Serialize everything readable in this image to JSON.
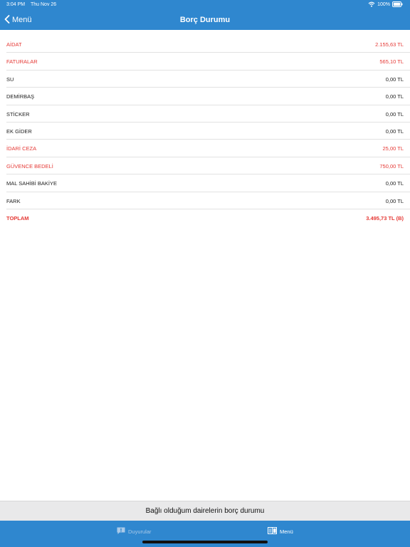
{
  "status_bar": {
    "time": "3:04 PM",
    "date": "Thu Nov 26",
    "battery": "100%"
  },
  "nav": {
    "back_label": "Menü",
    "title": "Borç Durumu"
  },
  "debts": [
    {
      "label": "AİDAT",
      "value": "2.155,63 TL",
      "highlight": true
    },
    {
      "label": "FATURALAR",
      "value": "565,10 TL",
      "highlight": true
    },
    {
      "label": "SU",
      "value": "0,00 TL",
      "highlight": false
    },
    {
      "label": "DEMİRBAŞ",
      "value": "0,00 TL",
      "highlight": false
    },
    {
      "label": "STİCKER",
      "value": "0,00 TL",
      "highlight": false
    },
    {
      "label": "EK GİDER",
      "value": "0,00 TL",
      "highlight": false
    },
    {
      "label": "İDARİ CEZA",
      "value": "25,00 TL",
      "highlight": true
    },
    {
      "label": "GÜVENCE BEDELİ",
      "value": "750,00 TL",
      "highlight": true
    },
    {
      "label": "MAL SAHİBİ BAKİYE",
      "value": "0,00 TL",
      "highlight": false
    },
    {
      "label": "FARK",
      "value": "0,00 TL",
      "highlight": false
    }
  ],
  "total": {
    "label": "TOPLAM",
    "value": "3.495,73 TL (B)"
  },
  "footer": {
    "text": "Bağlı olduğum dairelerin borç durumu"
  },
  "tabs": [
    {
      "label": "Duyurular",
      "icon": "announcement-icon",
      "active": false
    },
    {
      "label": "Menü",
      "icon": "book-icon",
      "active": true
    }
  ],
  "colors": {
    "header": "#2f87cf",
    "highlight": "#e53935",
    "footer_bg": "#e9e9ea"
  }
}
